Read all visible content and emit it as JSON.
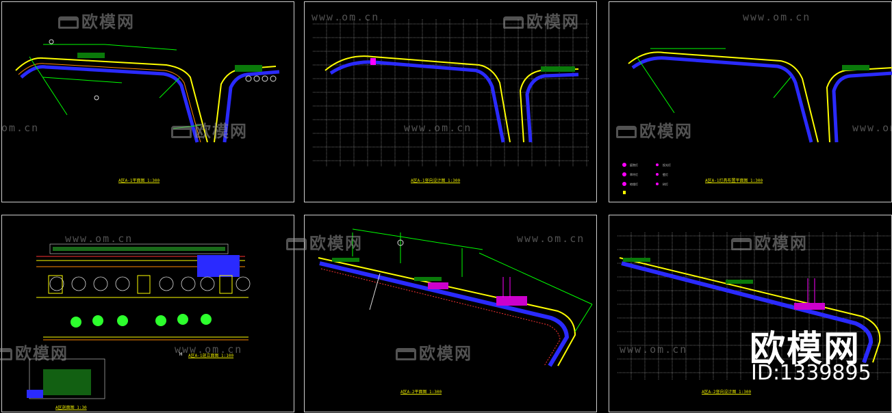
{
  "watermark": {
    "brand": "欧模网",
    "url": "www.om.cn",
    "url_short": "om.cn",
    "id_text": "ID:1339895"
  },
  "sheets": [
    {
      "title": "A区A-1平面图   1:300"
    },
    {
      "title": "A区A-1竖向设计图   1:300"
    },
    {
      "title": "A区A-1灯具布置平面图   1:300"
    },
    {
      "title": "A区立面图   1:100"
    },
    {
      "title": "A区A-2平面图   1:300"
    },
    {
      "title": "A区A-2竖向设计图   1:300"
    }
  ],
  "sheet4": {
    "subtitle": "A区A-1剖立面图   1:100",
    "section_title": "A区剖面图   1:30",
    "marker": "H"
  },
  "legend": [
    "庭院灯",
    "草坪灯",
    "地埋灯",
    "投光灯",
    "壁灯",
    "树灯"
  ],
  "colors": {
    "yellow": "#ffff00",
    "blue": "#2a2aff",
    "green": "#00ff00",
    "magenta": "#ff00ff",
    "grid": "#d8d8d8"
  }
}
